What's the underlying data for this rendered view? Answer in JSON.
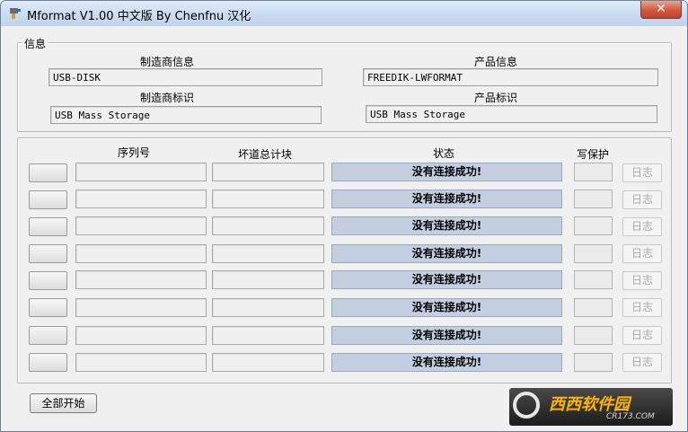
{
  "window": {
    "title": "Mformat V1.00 中文版 By Chenfnu 汉化",
    "close_label": "✕"
  },
  "info": {
    "legend": "信息",
    "manufacturer_info_label": "制造商信息",
    "manufacturer_info_value": "USB-DISK",
    "product_info_label": "产品信息",
    "product_info_value": "FREEDIK-LWFORMAT",
    "manufacturer_id_label": "制造商标识",
    "manufacturer_id_value": "USB Mass Storage",
    "product_id_label": "产品标识",
    "product_id_value": "USB Mass Storage"
  },
  "devices": {
    "headers": {
      "serial": "序列号",
      "bad_blocks": "坏道总计块",
      "status": "状态",
      "write_protect": "写保护"
    },
    "rows": [
      {
        "status": "没有连接成功!",
        "log_label": "日志"
      },
      {
        "status": "没有连接成功!",
        "log_label": "日志"
      },
      {
        "status": "没有连接成功!",
        "log_label": "日志"
      },
      {
        "status": "没有连接成功!",
        "log_label": "日志"
      },
      {
        "status": "没有连接成功!",
        "log_label": "日志"
      },
      {
        "status": "没有连接成功!",
        "log_label": "日志"
      },
      {
        "status": "没有连接成功!",
        "log_label": "日志"
      },
      {
        "status": "没有连接成功!",
        "log_label": "日志"
      }
    ]
  },
  "footer": {
    "start_all_label": "全部开始"
  },
  "watermark": {
    "name": "西西软件园",
    "url": "CR173.COM"
  },
  "colors": {
    "status_bg": "#c3cfe0",
    "titlebar": "#c9dbef",
    "close": "#c4412a",
    "watermark_text": "#ffb400"
  }
}
